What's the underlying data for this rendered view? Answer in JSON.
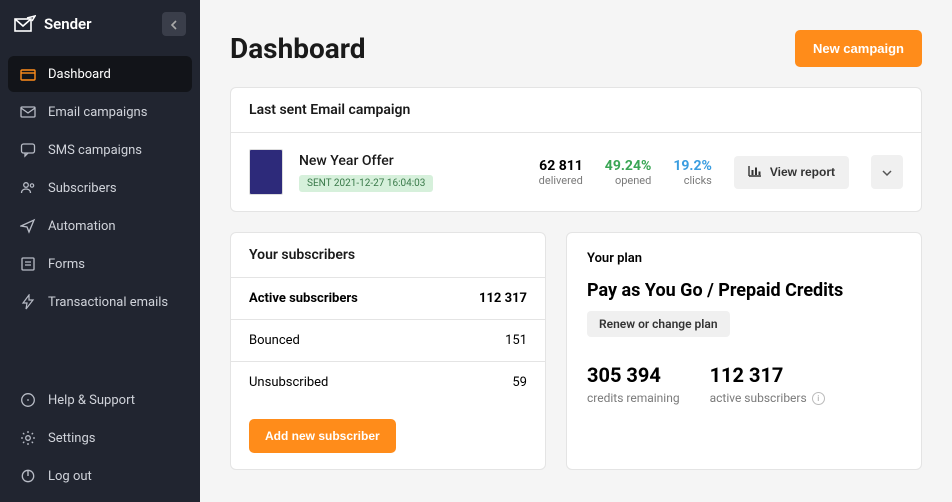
{
  "brand": "Sender",
  "sidebar": {
    "items": [
      {
        "label": "Dashboard"
      },
      {
        "label": "Email campaigns"
      },
      {
        "label": "SMS campaigns"
      },
      {
        "label": "Subscribers"
      },
      {
        "label": "Automation"
      },
      {
        "label": "Forms"
      },
      {
        "label": "Transactional emails"
      }
    ],
    "footer": [
      {
        "label": "Help & Support"
      },
      {
        "label": "Settings"
      },
      {
        "label": "Log out"
      }
    ]
  },
  "header": {
    "title": "Dashboard",
    "new_campaign_label": "New campaign"
  },
  "last_campaign": {
    "section_title": "Last sent Email campaign",
    "name": "New Year Offer",
    "badge": "SENT 2021-12-27 16:04:03",
    "stats": {
      "delivered": {
        "value": "62 811",
        "label": "delivered"
      },
      "opened": {
        "value": "49.24%",
        "label": "opened"
      },
      "clicks": {
        "value": "19.2%",
        "label": "clicks"
      }
    },
    "view_report_label": "View report"
  },
  "subscribers": {
    "title": "Your subscribers",
    "rows": [
      {
        "label": "Active subscribers",
        "value": "112 317"
      },
      {
        "label": "Bounced",
        "value": "151"
      },
      {
        "label": "Unsubscribed",
        "value": "59"
      }
    ],
    "add_label": "Add new subscriber"
  },
  "plan": {
    "title": "Your plan",
    "name": "Pay as You Go / Prepaid Credits",
    "change_label": "Renew or change plan",
    "stats": [
      {
        "value": "305 394",
        "label": "credits remaining"
      },
      {
        "value": "112 317",
        "label": "active subscribers"
      }
    ]
  }
}
